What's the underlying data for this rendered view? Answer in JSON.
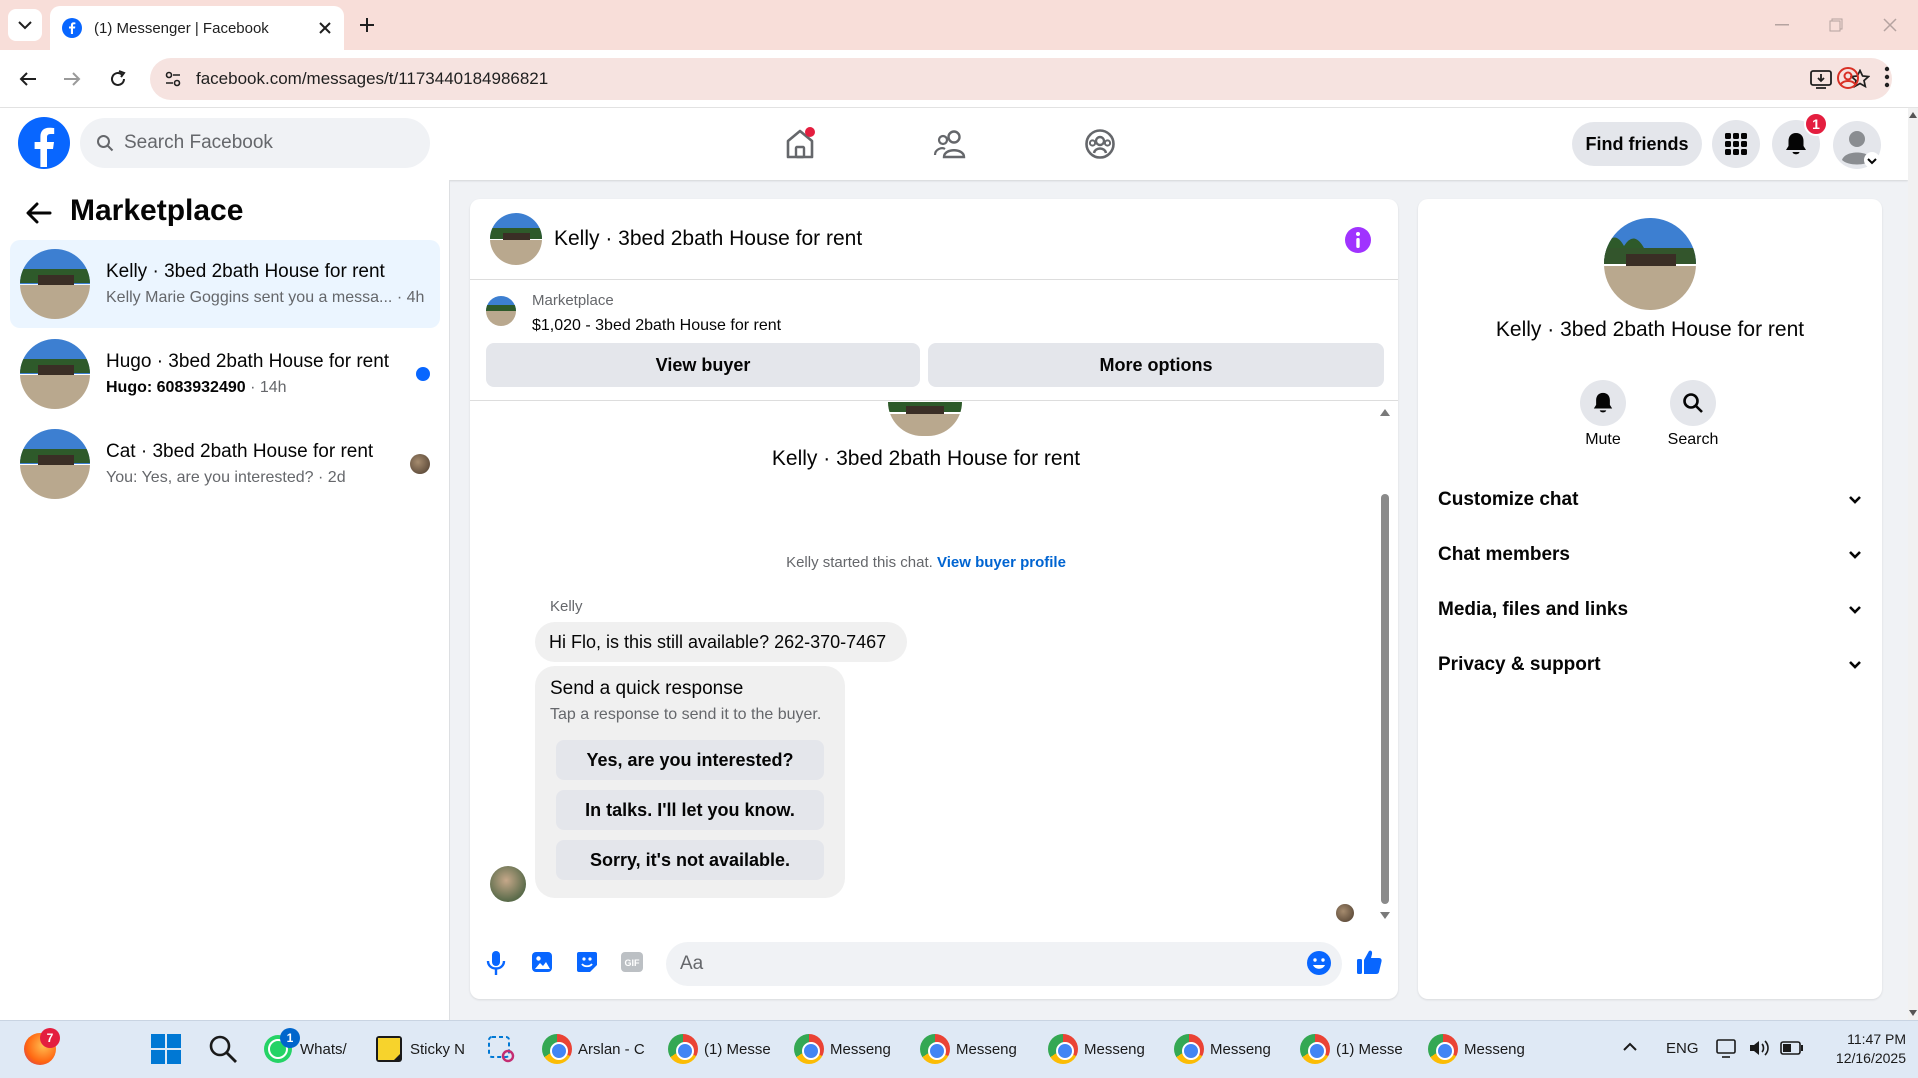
{
  "browser": {
    "tab_title": "(1) Messenger | Facebook",
    "url": "facebook.com/messages/t/1173440184986821"
  },
  "fb_header": {
    "search_placeholder": "Search Facebook",
    "find_friends": "Find friends",
    "notifications_count": "1"
  },
  "sidebar": {
    "title": "Marketplace",
    "conversations": [
      {
        "name": "Kelly · 3bed 2bath House for rent",
        "snippet": "Kelly Marie Goggins sent you a messa...",
        "time": "· 4h",
        "active": true,
        "unread": false
      },
      {
        "name": "Hugo · 3bed 2bath House for rent",
        "snippet": "Hugo: 6083932490",
        "time": "· 14h",
        "active": false,
        "unread": true
      },
      {
        "name": "Cat · 3bed 2bath House for rent",
        "snippet": "You: Yes, are you interested?",
        "time": "· 2d",
        "active": false,
        "unread": false
      }
    ]
  },
  "chat": {
    "title": "Kelly · 3bed 2bath House for rent",
    "listing": {
      "source": "Marketplace",
      "summary": "$1,020 - 3bed 2bath House for rent"
    },
    "buttons": {
      "view_buyer": "View buyer",
      "more_options": "More options"
    },
    "intro_title": "Kelly · 3bed 2bath House for rent",
    "started_text": "Kelly started this chat.",
    "view_buyer_profile": "View buyer profile",
    "sender_name": "Kelly",
    "message": "Hi Flo, is this still available? 262-370-7467",
    "quick_response": {
      "title": "Send a quick response",
      "subtitle": "Tap a response to send it to the buyer.",
      "options": [
        "Yes, are you interested?",
        "In talks. I'll let you know.",
        "Sorry, it's not available."
      ]
    },
    "input_placeholder": "Aa"
  },
  "info_panel": {
    "title": "Kelly · 3bed 2bath House for rent",
    "actions": {
      "mute": "Mute",
      "search": "Search"
    },
    "sections": [
      "Customize chat",
      "Chat members",
      "Media, files and links",
      "Privacy & support"
    ]
  },
  "taskbar": {
    "firefox_badge": "7",
    "whatsapp_badge": "1",
    "items": [
      "Whats/",
      "Sticky N",
      "Arslan - C",
      "(1) Messe",
      "Messeng",
      "Messeng",
      "Messeng",
      "Messeng",
      "(1) Messe",
      "Messeng"
    ],
    "lang": "ENG",
    "time": "11:47 PM",
    "date": "12/16/2025"
  },
  "colors": {
    "fb_blue": "#0866ff",
    "accent_purple": "#a033ff",
    "link_blue": "#0064d1",
    "unread_dot": "#0866ff",
    "notification_red": "#e41e3f"
  },
  "icons": [
    "facebook-logo-icon",
    "search-icon",
    "home-icon",
    "friends-icon",
    "groups-icon",
    "menu-grid-icon",
    "bell-icon",
    "info-icon",
    "mic-icon",
    "image-icon",
    "sticker-icon",
    "gif-icon",
    "emoji-icon",
    "like-icon",
    "chevron-down-icon"
  ]
}
